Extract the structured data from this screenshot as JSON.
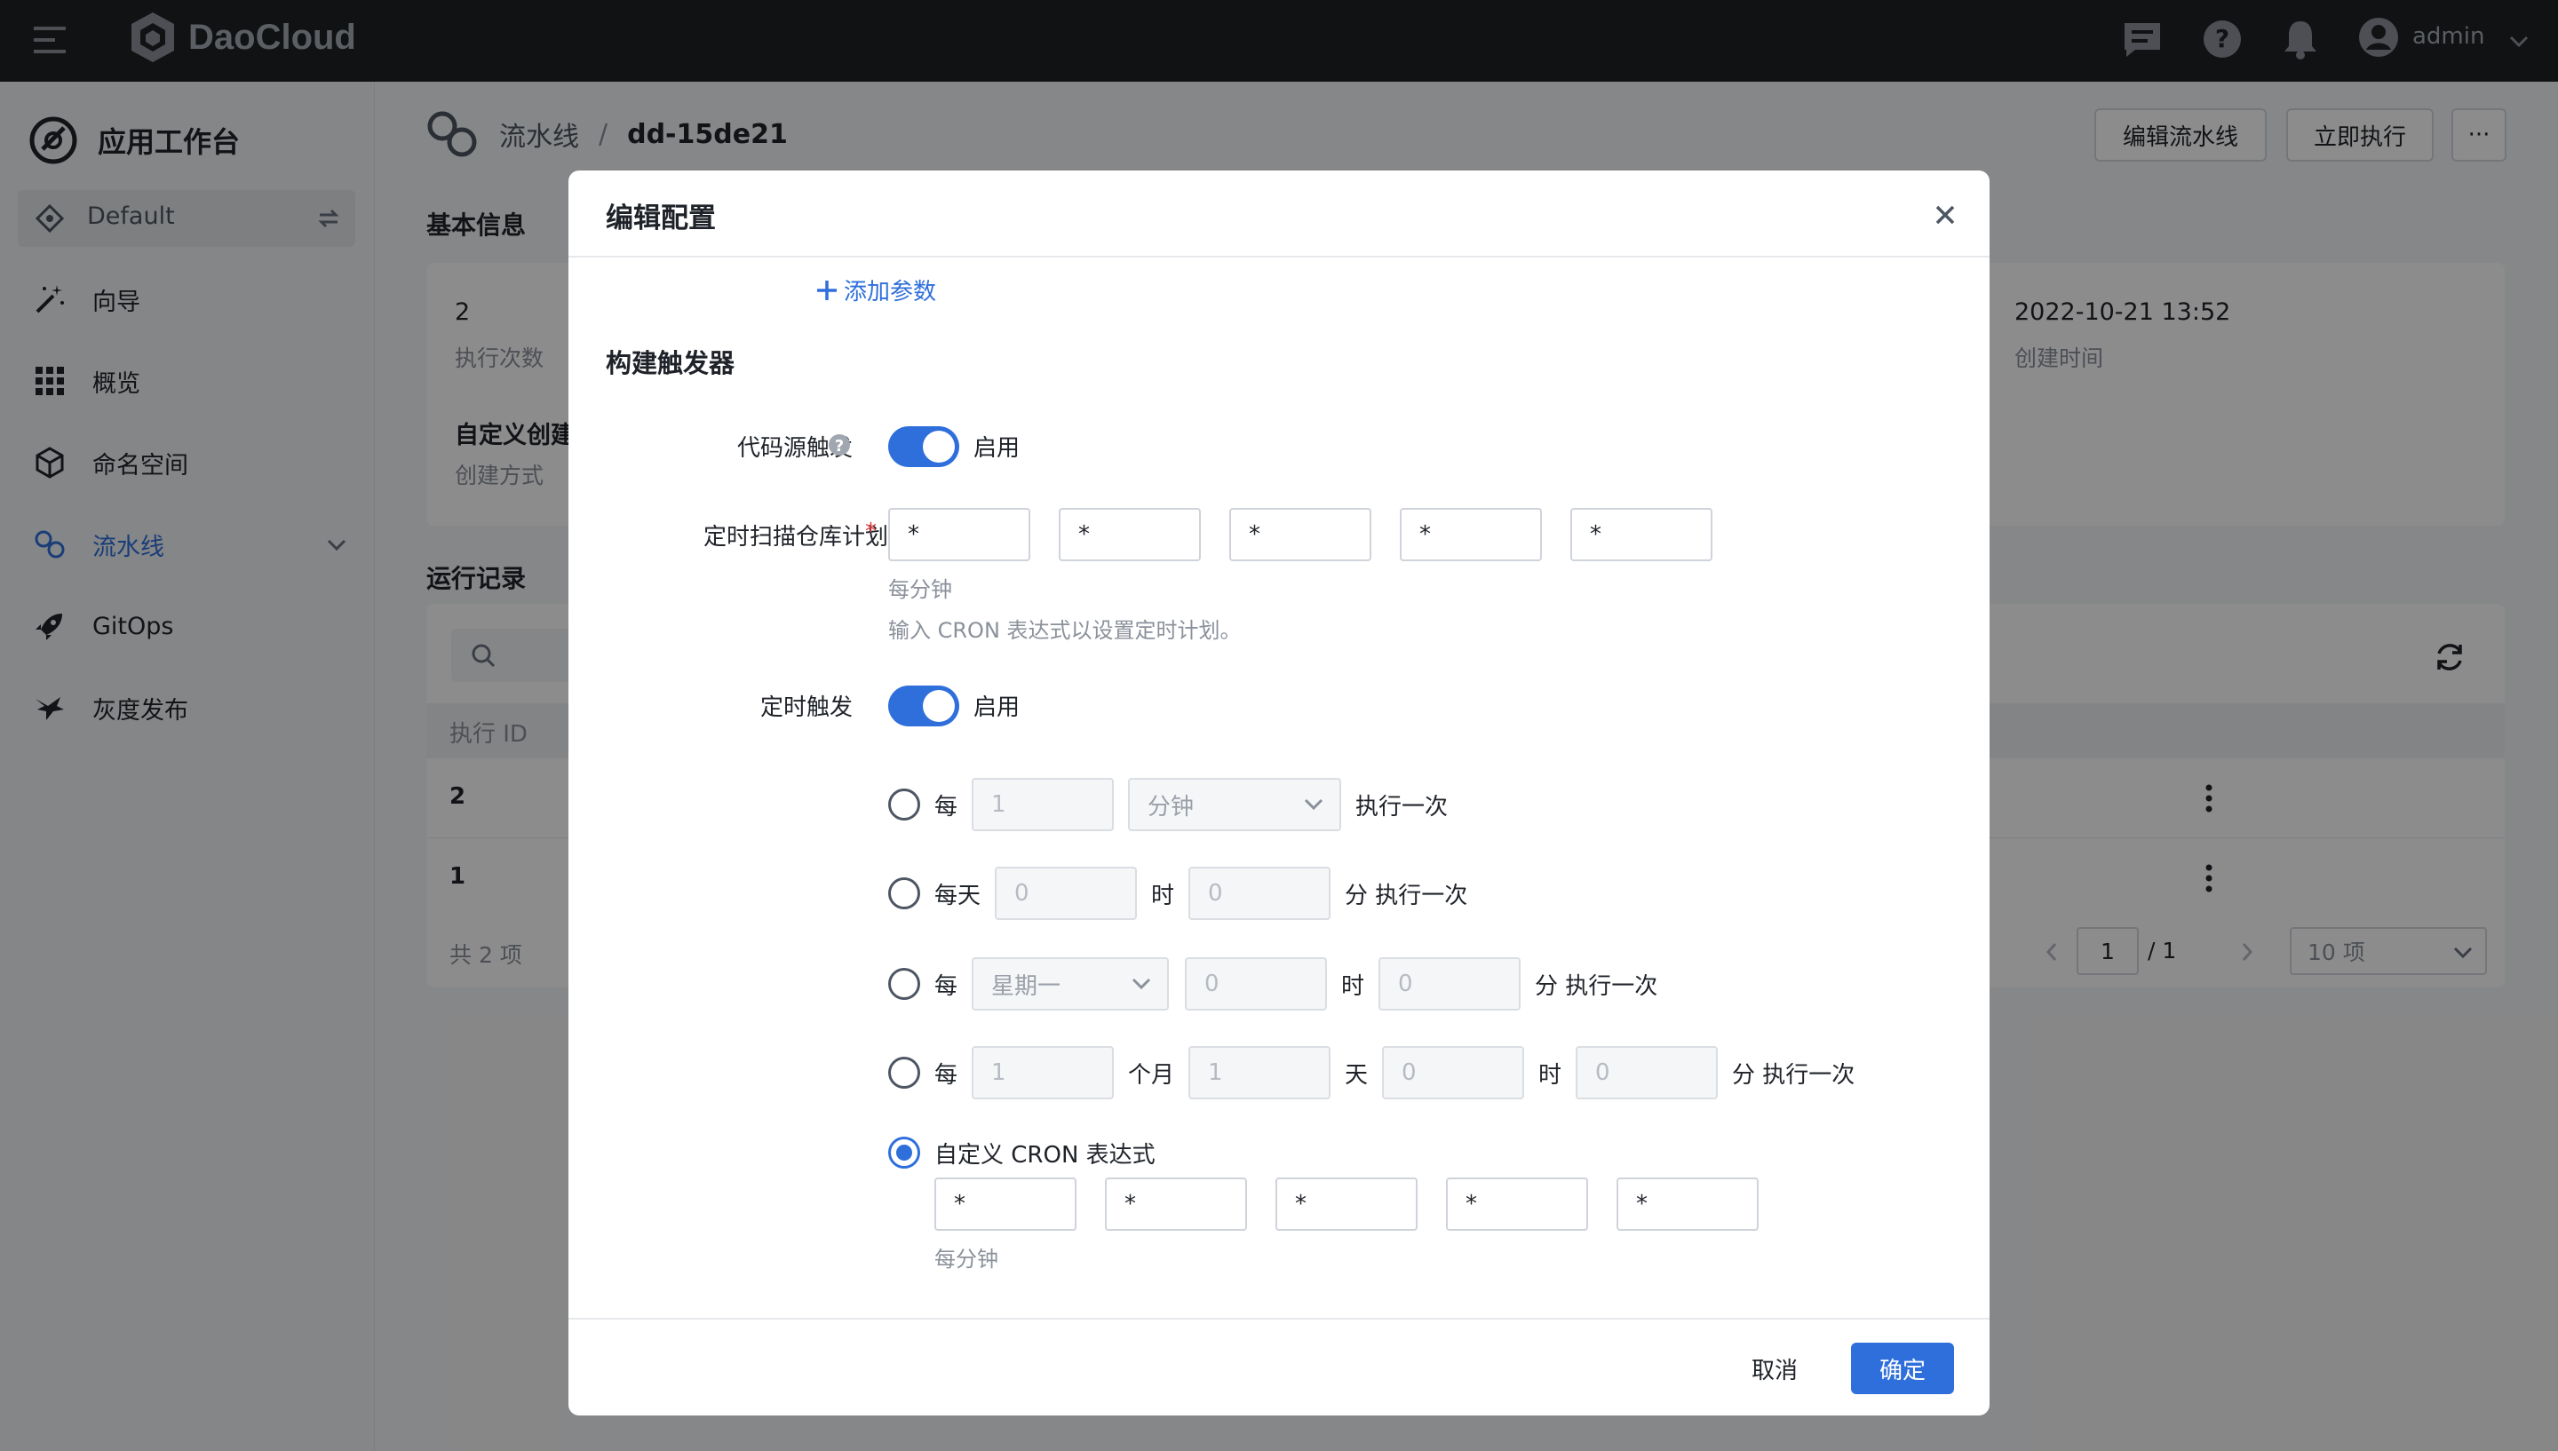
{
  "topbar": {
    "brand": "DaoCloud",
    "user": "admin"
  },
  "sidebar": {
    "title": "应用工作台",
    "workspace": "Default",
    "items": [
      {
        "label": "向导",
        "icon": "wand-icon"
      },
      {
        "label": "概览",
        "icon": "grid-icon"
      },
      {
        "label": "命名空间",
        "icon": "cube-icon"
      },
      {
        "label": "流水线",
        "icon": "pipeline-icon",
        "active": true
      },
      {
        "label": "GitOps",
        "icon": "rocket-icon"
      },
      {
        "label": "灰度发布",
        "icon": "bird-icon"
      }
    ]
  },
  "page": {
    "breadcrumb": {
      "parent": "流水线",
      "separator": "/",
      "current": "dd-15de21"
    },
    "actions": {
      "edit": "编辑流水线",
      "run": "立即执行",
      "more": "···"
    },
    "basic_info": {
      "title": "基本信息",
      "run_count_value": "2",
      "run_count_label": "执行次数",
      "create_mode_value": "自定义创建",
      "create_mode_label": "创建方式",
      "created_value": "2022-10-21 13:52",
      "created_label": "创建时间"
    },
    "records": {
      "title": "运行记录",
      "col_id": "执行 ID",
      "rows": [
        "2",
        "1"
      ],
      "total": "共 2 项",
      "page": "1",
      "pages": "/ 1",
      "page_size": "10 项"
    }
  },
  "modal": {
    "title": "编辑配置",
    "add_param": "添加参数",
    "section_title": "构建触发器",
    "code_trigger_label": "代码源触发",
    "code_trigger_state": "启用",
    "scan_label": "定时扫描仓库计划",
    "scan_fields": [
      "*",
      "*",
      "*",
      "*",
      "*"
    ],
    "scan_hint1": "每分钟",
    "scan_hint2": "输入 CRON 表达式以设置定时计划。",
    "timer_label": "定时触发",
    "timer_state": "启用",
    "opt1": {
      "prefix": "每",
      "value": "1",
      "unit": "分钟",
      "suffix": "执行一次"
    },
    "opt2": {
      "prefix": "每天",
      "hour": "0",
      "hour_unit": "时",
      "minute": "0",
      "suffix": "分 执行一次"
    },
    "opt3": {
      "prefix": "每",
      "weekday": "星期一",
      "hour": "0",
      "hour_unit": "时",
      "minute": "0",
      "suffix": "分 执行一次"
    },
    "opt4": {
      "prefix": "每",
      "month": "1",
      "month_unit": "个月",
      "day": "1",
      "day_unit": "天",
      "hour": "0",
      "hour_unit": "时",
      "minute": "0",
      "suffix": "分 执行一次"
    },
    "opt5": {
      "label": "自定义 CRON 表达式",
      "fields": [
        "*",
        "*",
        "*",
        "*",
        "*"
      ],
      "hint": "每分钟"
    },
    "cancel": "取消",
    "ok": "确定"
  },
  "colors": {
    "accent": "#2f6fdb",
    "topbar": "#1f2226",
    "required": "#e03d3d"
  }
}
